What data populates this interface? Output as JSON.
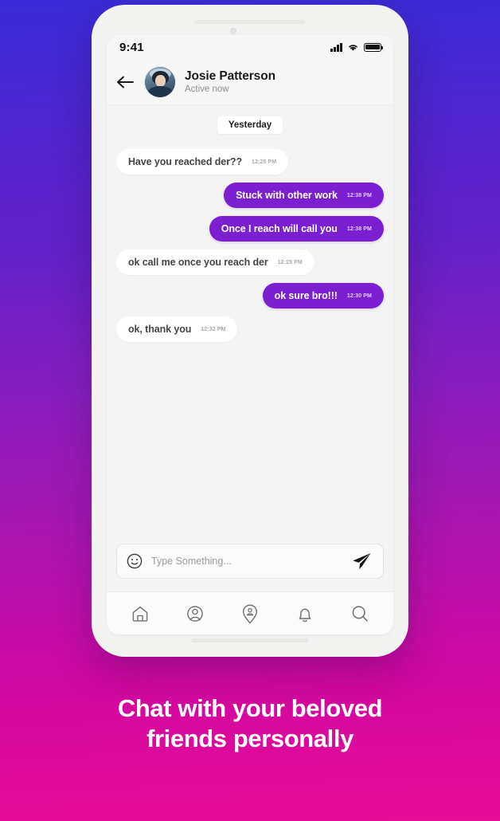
{
  "background": {
    "gradient_top": "#3a2bd6",
    "gradient_mid": "#8a1ec0",
    "gradient_bottom": "#e80c97"
  },
  "theme": {
    "accent_purple": "#7b1fd0",
    "screen_bg": "#f4f4f4",
    "bubble_in_bg": "#ffffff"
  },
  "status_bar": {
    "time": "9:41",
    "signal_icon": "cellular-signal-icon",
    "wifi_icon": "wifi-icon",
    "battery_icon": "battery-full-icon"
  },
  "chat_header": {
    "back_icon": "back-arrow-icon",
    "avatar_icon": "avatar-image",
    "peer_name": "Josie Patterson",
    "peer_status": "Active now"
  },
  "conversation": {
    "day_divider": "Yesterday",
    "messages": [
      {
        "direction": "in",
        "text": "Have you reached der??",
        "time": "12:25 PM"
      },
      {
        "direction": "out",
        "text": "Stuck with other work",
        "time": "12:38 PM"
      },
      {
        "direction": "out",
        "text": "Once I reach will call you",
        "time": "12:38 PM"
      },
      {
        "direction": "in",
        "text": "ok call me once you reach der",
        "time": "12:25 PM"
      },
      {
        "direction": "out",
        "text": "ok sure bro!!!",
        "time": "12:30 PM"
      },
      {
        "direction": "in",
        "text": "ok, thank you",
        "time": "12:32 PM"
      }
    ]
  },
  "composer": {
    "emoji_icon": "smiley-face-icon",
    "placeholder": "Type Something...",
    "value": "",
    "send_icon": "send-paper-plane-icon"
  },
  "bottom_nav": {
    "items": [
      {
        "icon": "home-icon",
        "label": "Home"
      },
      {
        "icon": "profile-icon",
        "label": "Profile"
      },
      {
        "icon": "location-pin-icon",
        "label": "Nearby"
      },
      {
        "icon": "bell-icon",
        "label": "Notifications"
      },
      {
        "icon": "search-icon",
        "label": "Search"
      }
    ]
  },
  "caption": {
    "line1": "Chat with your beloved",
    "line2": "friends personally"
  }
}
